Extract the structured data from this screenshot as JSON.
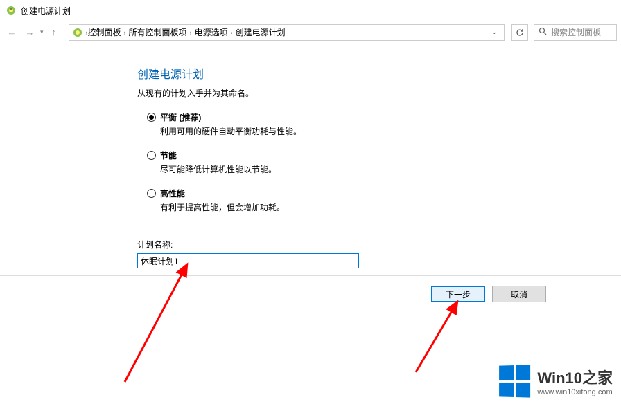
{
  "titlebar": {
    "title": "创建电源计划"
  },
  "breadcrumb": {
    "items": [
      "控制面板",
      "所有控制面板项",
      "电源选项",
      "创建电源计划"
    ]
  },
  "search": {
    "placeholder": "搜索控制面板"
  },
  "page": {
    "title": "创建电源计划",
    "subtitle": "从现有的计划入手并为其命名。"
  },
  "options": {
    "balanced": {
      "label": "平衡 (推荐)",
      "desc": "利用可用的硬件自动平衡功耗与性能。"
    },
    "saver": {
      "label": "节能",
      "desc": "尽可能降低计算机性能以节能。"
    },
    "high": {
      "label": "高性能",
      "desc": "有利于提高性能，但会增加功耗。"
    }
  },
  "plan_name": {
    "label": "计划名称:",
    "value": "休眠计划1"
  },
  "buttons": {
    "next": "下一步",
    "cancel": "取消"
  },
  "watermark": {
    "title": "Win10之家",
    "url": "www.win10xitong.com"
  }
}
